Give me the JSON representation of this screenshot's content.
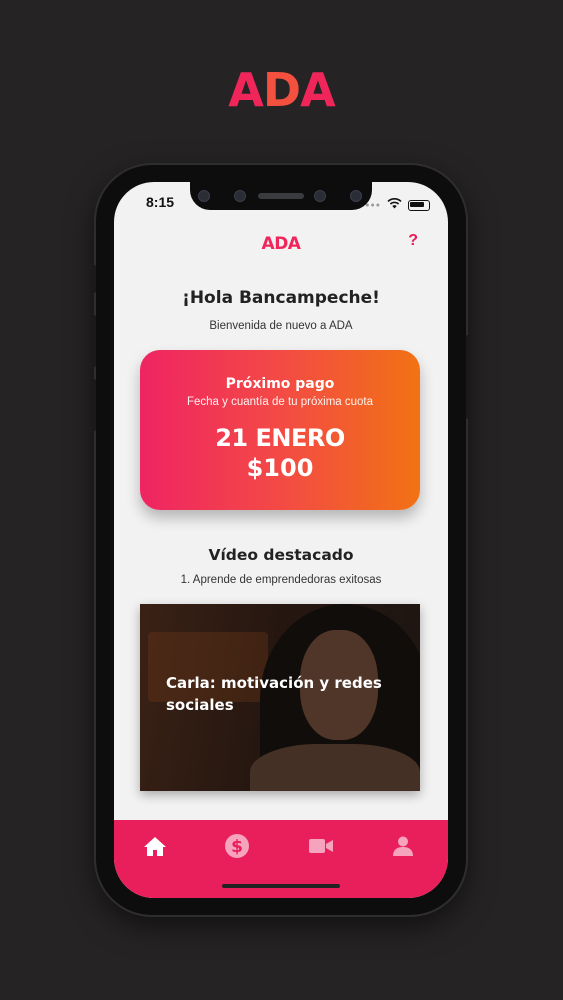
{
  "brand": {
    "logo": "ADA",
    "logo_parts": [
      "A",
      "D",
      "A"
    ]
  },
  "status_bar": {
    "time": "8:15"
  },
  "app_header": {
    "logo": "ADA",
    "help_label": "?"
  },
  "greeting": {
    "title": "¡Hola Bancampeche!",
    "subtitle": "Bienvenida de nuevo a ADA"
  },
  "payment_card": {
    "title": "Próximo pago",
    "subtitle": "Fecha y cuantía de tu próxima cuota",
    "date": "21 ENERO",
    "amount": "$100"
  },
  "featured_video": {
    "heading": "Vídeo destacado",
    "subtitle": "1. Aprende de emprendedoras exitosas",
    "video_title": "Carla: motivación y redes sociales"
  },
  "tab_bar": {
    "tabs": [
      {
        "icon": "home-icon",
        "active": true
      },
      {
        "icon": "dollar-icon",
        "active": false
      },
      {
        "icon": "video-camera-icon",
        "active": false
      },
      {
        "icon": "user-icon",
        "active": false
      }
    ]
  },
  "colors": {
    "brand_pink": "#e91f5b",
    "gradient_start": "#ef2463",
    "gradient_end": "#f27214",
    "background": "#262324",
    "screen_bg": "#f2f2f2"
  }
}
